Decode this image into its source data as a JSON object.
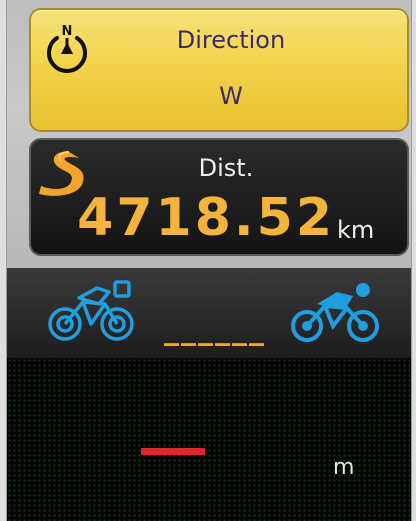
{
  "direction": {
    "label": "Direction",
    "value": "W",
    "compass_north_label": "N",
    "icon": "compass-icon",
    "accent_color": "#f2d34a"
  },
  "distance": {
    "label": "Dist.",
    "value": "4718.52",
    "unit": "km",
    "icon": "route-icon",
    "value_color": "#f4b33a"
  },
  "rivals": {
    "left_icon": "cyclist-icon",
    "right_icon": "cyclist-icon",
    "gap_text": "______",
    "bike_color": "#1f9fe0"
  },
  "graph": {
    "unit": "m",
    "bar_color": "#e0262b"
  }
}
